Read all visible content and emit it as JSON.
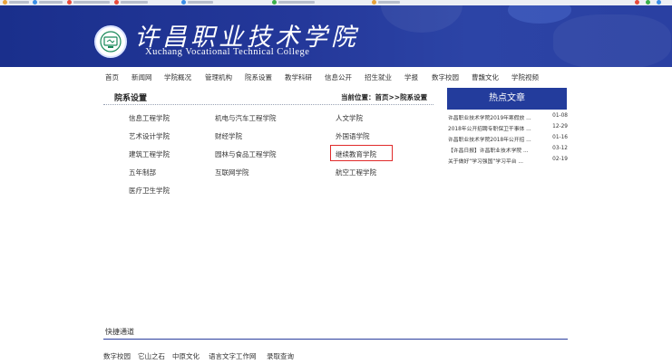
{
  "site": {
    "title_cn": "许昌职业技术学院",
    "title_en": "Xuchang Vocational Technical College"
  },
  "nav": {
    "items": [
      "首页",
      "新闻网",
      "学院概况",
      "管理机构",
      "院系设置",
      "教学科研",
      "信息公开",
      "招生就业",
      "学报",
      "数字校园",
      "曹魏文化",
      "学院视频"
    ]
  },
  "content": {
    "heading": "院系设置",
    "breadcrumb": "当前位置：首页>>院系设置",
    "departments": [
      [
        "信息工程学院",
        "机电与汽车工程学院",
        "人文学院"
      ],
      [
        "艺术设计学院",
        "财经学院",
        "外国语学院"
      ],
      [
        "建筑工程学院",
        "园林与食品工程学院",
        "继续教育学院"
      ],
      [
        "五年制部",
        "互联网学院",
        "航空工程学院"
      ],
      [
        "医疗卫生学院"
      ]
    ]
  },
  "hot": {
    "heading": "热点文章",
    "items": [
      {
        "title": "许昌职业技术学院2019年寒假放 ...",
        "date": "01-08"
      },
      {
        "title": "2018年公开招聘专职保卫干事体 ...",
        "date": "12-29"
      },
      {
        "title": "许昌职业技术学院2018年公开招 ...",
        "date": "01-16"
      },
      {
        "title": "【许昌日报】许昌职业技术学院 ...",
        "date": "03-12"
      },
      {
        "title": "关于做好“学习强国”学习平台 ...",
        "date": "02-19"
      }
    ]
  },
  "footer": {
    "quick_title": "快捷通道",
    "links": [
      "数字校园",
      "它山之石",
      "中原文化",
      "语言文字工作网",
      "录取查询"
    ]
  },
  "colors": {
    "banner": "#24389a",
    "hot_header": "#233c9c",
    "highlight": "#e02a2a"
  }
}
